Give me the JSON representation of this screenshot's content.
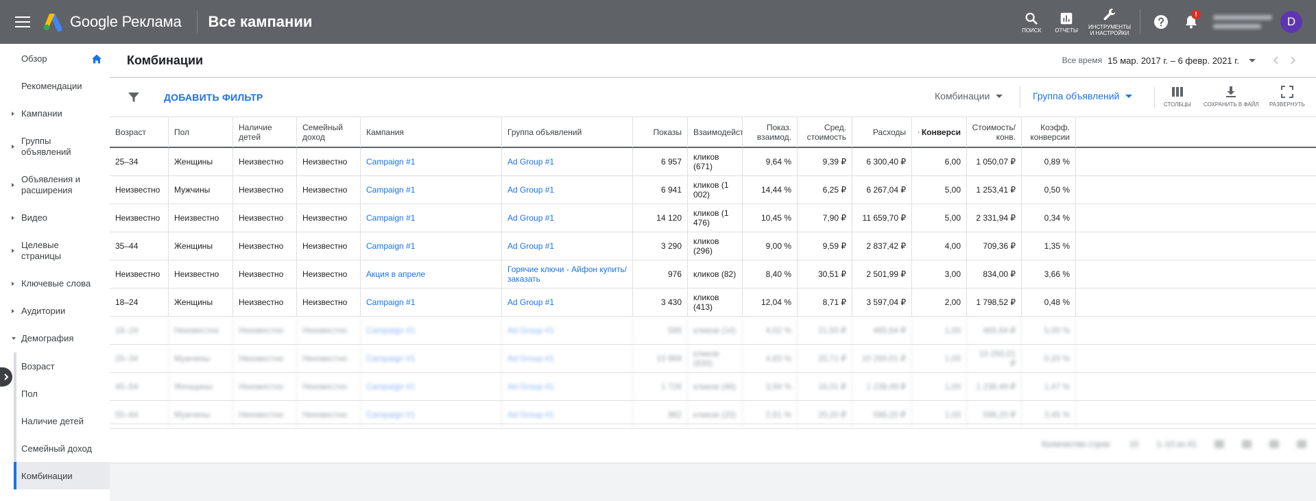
{
  "app": {
    "brand": "Google Реклама",
    "page_header": "Все кампании",
    "actions": [
      {
        "label": "ПОИСК",
        "icon": "search-icon"
      },
      {
        "label": "ОТЧЕТЫ",
        "icon": "reports-icon"
      },
      {
        "label": "ИНСТРУМЕНТЫ И НАСТРОЙКИ",
        "icon": "wrench-icon"
      }
    ],
    "notification_badge": "!",
    "avatar_letter": "D"
  },
  "sidebar": {
    "items": [
      {
        "label": "Обзор",
        "arrow": "none"
      },
      {
        "label": "Рекомендации",
        "arrow": "none"
      },
      {
        "label": "Кампании",
        "arrow": "right"
      },
      {
        "label": "Группы объявлений",
        "arrow": "right"
      },
      {
        "label": "Объявления и расширения",
        "arrow": "right"
      },
      {
        "label": "Видео",
        "arrow": "right"
      },
      {
        "label": "Целевые страницы",
        "arrow": "right"
      },
      {
        "label": "Ключевые слова",
        "arrow": "right"
      },
      {
        "label": "Аудитории",
        "arrow": "right"
      },
      {
        "label": "Демография",
        "arrow": "down"
      }
    ],
    "subitems": [
      {
        "label": "Возраст",
        "active": false
      },
      {
        "label": "Пол",
        "active": false
      },
      {
        "label": "Наличие детей",
        "active": false
      },
      {
        "label": "Семейный доход",
        "active": false
      },
      {
        "label": "Комбинации",
        "active": true
      }
    ]
  },
  "main": {
    "title": "Комбинации",
    "date_label": "Все время",
    "date_range": "15 мар. 2017 г. – 6 февр. 2021 г."
  },
  "toolbar": {
    "add_filter": "ДОБАВИТЬ ФИЛЬТР",
    "segment1": "Комбинации",
    "segment2": "Группа объявлений",
    "tools": [
      {
        "label": "СТОЛБЦЫ",
        "icon": "columns-icon"
      },
      {
        "label": "СОХРАНИТЬ В ФАЙЛ",
        "icon": "download-icon"
      },
      {
        "label": "РАЗВЕРНУТЬ",
        "icon": "fullscreen-icon"
      }
    ]
  },
  "table": {
    "columns": [
      {
        "label": "Возраст",
        "num": false
      },
      {
        "label": "Пол",
        "num": false
      },
      {
        "label": "Наличие детей",
        "num": false
      },
      {
        "label": "Семейный доход",
        "num": false
      },
      {
        "label": "Кампания",
        "num": false
      },
      {
        "label": "Группа объявлений",
        "num": false
      },
      {
        "label": "Показы",
        "num": true
      },
      {
        "label": "Взаимодейств",
        "num": false
      },
      {
        "label": "Показ. взаимод.",
        "num": true
      },
      {
        "label": "Сред. стоимость",
        "num": true
      },
      {
        "label": "Расходы",
        "num": true
      },
      {
        "label": "Конверси",
        "num": true,
        "sorted": true
      },
      {
        "label": "Стоимость/ конв.",
        "num": true
      },
      {
        "label": "Коэфф. конверсии",
        "num": true
      }
    ],
    "rows": [
      [
        "25–34",
        "Женщины",
        "Неизвестно",
        "Неизвестно",
        "Campaign #1",
        "Ad Group #1",
        "6 957",
        "кликов (671)",
        "9,64 %",
        "9,39 ₽",
        "6 300,40 ₽",
        "6,00",
        "1 050,07 ₽",
        "0,89 %"
      ],
      [
        "Неизвестно",
        "Мужчины",
        "Неизвестно",
        "Неизвестно",
        "Campaign #1",
        "Ad Group #1",
        "6 941",
        "кликов (1 002)",
        "14,44 %",
        "6,25 ₽",
        "6 267,04 ₽",
        "5,00",
        "1 253,41 ₽",
        "0,50 %"
      ],
      [
        "Неизвестно",
        "Неизвестно",
        "Неизвестно",
        "Неизвестно",
        "Campaign #1",
        "Ad Group #1",
        "14 120",
        "кликов (1 476)",
        "10,45 %",
        "7,90 ₽",
        "11 659,70 ₽",
        "5,00",
        "2 331,94 ₽",
        "0,34 %"
      ],
      [
        "35–44",
        "Женщины",
        "Неизвестно",
        "Неизвестно",
        "Campaign #1",
        "Ad Group #1",
        "3 290",
        "кликов (296)",
        "9,00 %",
        "9,59 ₽",
        "2 837,42 ₽",
        "4,00",
        "709,36 ₽",
        "1,35 %"
      ],
      [
        "Неизвестно",
        "Неизвестно",
        "Неизвестно",
        "Неизвестно",
        "Акция в апреле",
        "Горячие ключи - Айфон купить/ заказать",
        "976",
        "кликов (82)",
        "8,40 %",
        "30,51 ₽",
        "2 501,99 ₽",
        "3,00",
        "834,00 ₽",
        "3,66 %"
      ],
      [
        "18–24",
        "Женщины",
        "Неизвестно",
        "Неизвестно",
        "Campaign #1",
        "Ad Group #1",
        "3 430",
        "кликов (413)",
        "12,04 %",
        "8,71 ₽",
        "3 597,04 ₽",
        "2,00",
        "1 798,52 ₽",
        "0,48 %"
      ]
    ],
    "blurred_rows": [
      [
        "18–24",
        "Неизвестно",
        "Неизвестно",
        "Неизвестно",
        "Campaign #1",
        "Ad Group #1",
        "586",
        "кликов (14)",
        "4,02 %",
        "21,50 ₽",
        "465,64 ₽",
        "1,00",
        "465,64 ₽",
        "5,00 %"
      ],
      [
        "25–34",
        "Мужчины",
        "Неизвестно",
        "Неизвестно",
        "Campaign #1",
        "Ad Group #1",
        "10 969",
        "кликов (830)",
        "4,83 %",
        "20,71 ₽",
        "10 250,01 ₽",
        "1,00",
        "10 250,01 ₽",
        "0,20 %"
      ],
      [
        "45–54",
        "Женщины",
        "Неизвестно",
        "Неизвестно",
        "Campaign #1",
        "Ad Group #1",
        "1 726",
        "кликов (48)",
        "3,94 %",
        "16,01 ₽",
        "1 238,49 ₽",
        "1,00",
        "1 238,49 ₽",
        "1,47 %"
      ],
      [
        "55–64",
        "Мужчины",
        "Неизвестно",
        "Неизвестно",
        "Campaign #1",
        "Ad Group #1",
        "982",
        "кликов (20)",
        "2,91 %",
        "20,20 ₽",
        "598,20 ₽",
        "1,00",
        "598,20 ₽",
        "3,45 %"
      ]
    ]
  },
  "pager": {
    "rows_label": "Количество строк:",
    "rows_value": "10",
    "range": "1–10 из 41"
  },
  "colors": {
    "topbar": "#5f6368",
    "accent": "#1a73e8",
    "avatar": "#5e35b1",
    "badge": "#d93025"
  }
}
